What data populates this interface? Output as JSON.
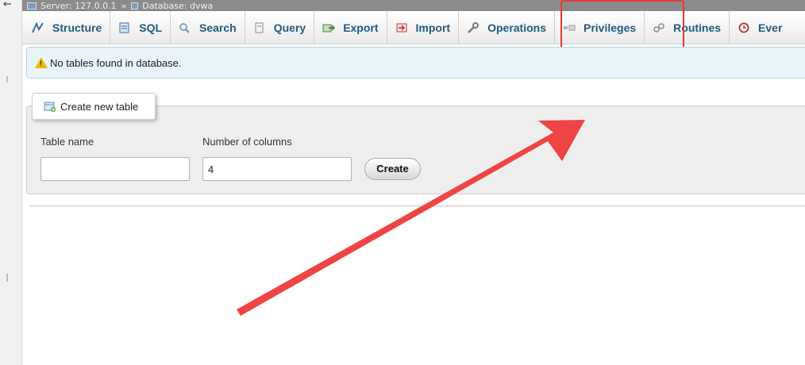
{
  "breadcrumb": {
    "back": "←",
    "server": "Server: 127.0.0.1",
    "separator": "»",
    "database": "Database: dvwa"
  },
  "tabs": [
    {
      "label": "Structure",
      "icon": "structure-icon"
    },
    {
      "label": "SQL",
      "icon": "sql-icon"
    },
    {
      "label": "Search",
      "icon": "search-icon"
    },
    {
      "label": "Query",
      "icon": "query-icon"
    },
    {
      "label": "Export",
      "icon": "export-icon"
    },
    {
      "label": "Import",
      "icon": "import-icon"
    },
    {
      "label": "Operations",
      "icon": "wrench-icon"
    },
    {
      "label": "Privileges",
      "icon": "privileges-icon"
    },
    {
      "label": "Routines",
      "icon": "routines-icon"
    },
    {
      "label": "Ever",
      "icon": "events-icon"
    }
  ],
  "notice": {
    "text": "No tables found in database.",
    "icon": "warning-icon"
  },
  "create_table": {
    "legend": "Create new table",
    "table_name_label": "Table name",
    "table_name_value": "",
    "columns_label": "Number of columns",
    "columns_value": "4",
    "create_button": "Create"
  },
  "colors": {
    "tab_text": "#235a81",
    "highlight": "#e53935",
    "arrow": "#ef4444",
    "notice_bg": "#e9f4f8"
  }
}
